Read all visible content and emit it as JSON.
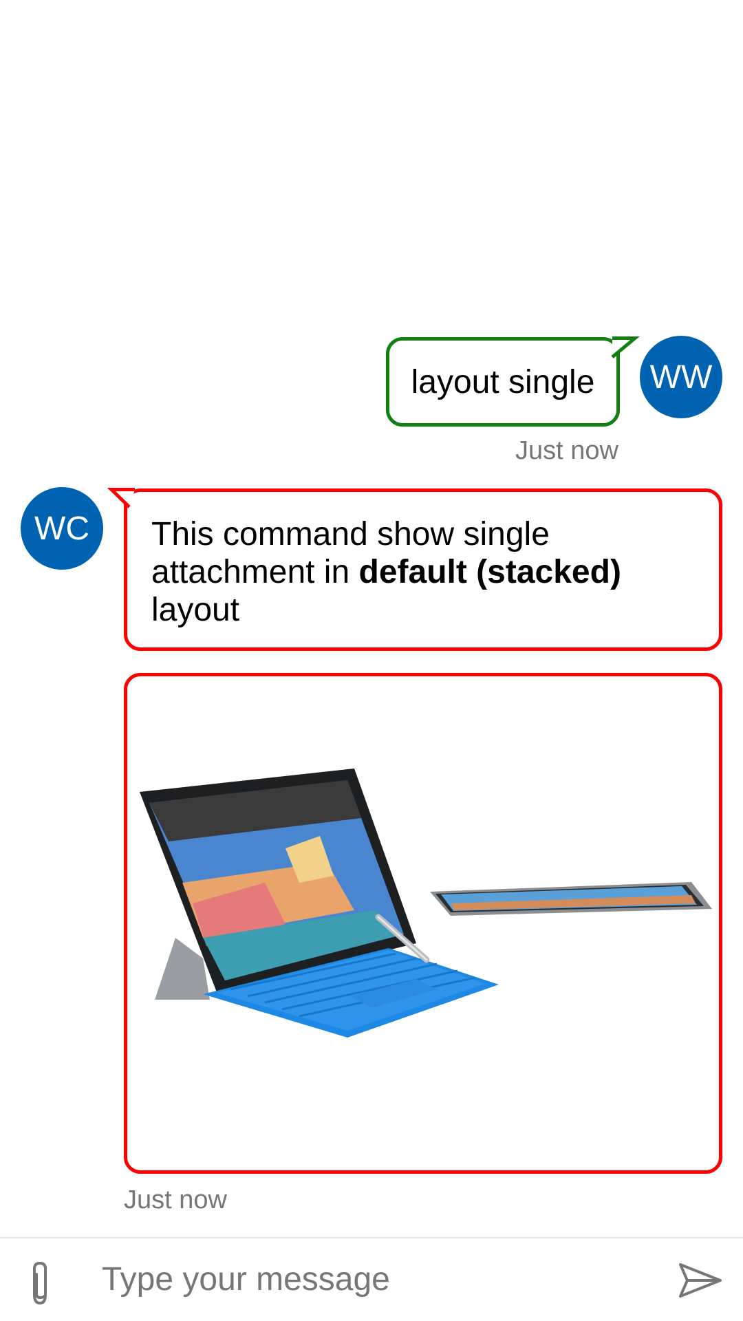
{
  "conversation": {
    "user_message": {
      "avatar_initials": "WW",
      "text": "layout single",
      "timestamp": "Just now"
    },
    "bot_message": {
      "avatar_initials": "WC",
      "text_before_bold": "This command show single attachment in ",
      "text_bold": "default (stacked)",
      "text_after_bold": " layout",
      "attachment_image": "Surface Pro 4 laptop with blue type cover and stylus, plus a second tablet lying flat",
      "timestamp": "Just now"
    }
  },
  "composer": {
    "placeholder": "Type your message",
    "attach_icon": "paperclip-icon",
    "send_icon": "send-icon"
  },
  "colors": {
    "avatar": "#0063b1",
    "user_bubble_border": "#108010",
    "bot_bubble_border": "#ff0000",
    "timestamp": "#767676"
  }
}
